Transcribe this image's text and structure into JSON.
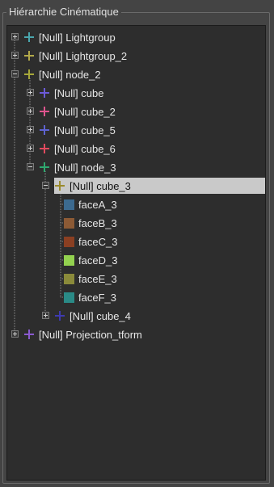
{
  "panel": {
    "title": "Hiérarchie Cinématique"
  },
  "tree": {
    "nodes": [
      {
        "label": "[Null] Lightgroup",
        "kind": "null",
        "color": "#4aa6ad",
        "expander": "collapsed"
      },
      {
        "label": "[Null] Lightgroup_2",
        "kind": "null",
        "color": "#b3a94a",
        "expander": "collapsed"
      },
      {
        "label": "[Null] node_2",
        "kind": "null",
        "color": "#a7a83a",
        "expander": "expanded"
      },
      {
        "label": "[Null] cube",
        "kind": "null",
        "color": "#6c5ad8",
        "expander": "collapsed"
      },
      {
        "label": "[Null] cube_2",
        "kind": "null",
        "color": "#e0558e",
        "expander": "collapsed"
      },
      {
        "label": "[Null] cube_5",
        "kind": "null",
        "color": "#5e63d0",
        "expander": "collapsed"
      },
      {
        "label": "[Null] cube_6",
        "kind": "null",
        "color": "#e24a5e",
        "expander": "collapsed"
      },
      {
        "label": "[Null] node_3",
        "kind": "null",
        "color": "#2fa86f",
        "expander": "expanded"
      },
      {
        "label": "[Null] cube_3",
        "kind": "null",
        "color": "#9a8a2c",
        "expander": "expanded",
        "selected": true
      },
      {
        "label": "faceA_3",
        "kind": "face",
        "color": "#3c6a8f"
      },
      {
        "label": "faceB_3",
        "kind": "face",
        "color": "#8c5a35"
      },
      {
        "label": "faceC_3",
        "kind": "face",
        "color": "#8a3f22"
      },
      {
        "label": "faceD_3",
        "kind": "face",
        "color": "#93d14f"
      },
      {
        "label": "faceE_3",
        "kind": "face",
        "color": "#8a8a3a"
      },
      {
        "label": "faceF_3",
        "kind": "face",
        "color": "#2a8a86"
      },
      {
        "label": "[Null] cube_4",
        "kind": "null",
        "color": "#3e3ab0",
        "expander": "collapsed"
      },
      {
        "label": "[Null] Projection_tform",
        "kind": "null",
        "color": "#8a5ad0",
        "expander": "collapsed"
      }
    ]
  }
}
